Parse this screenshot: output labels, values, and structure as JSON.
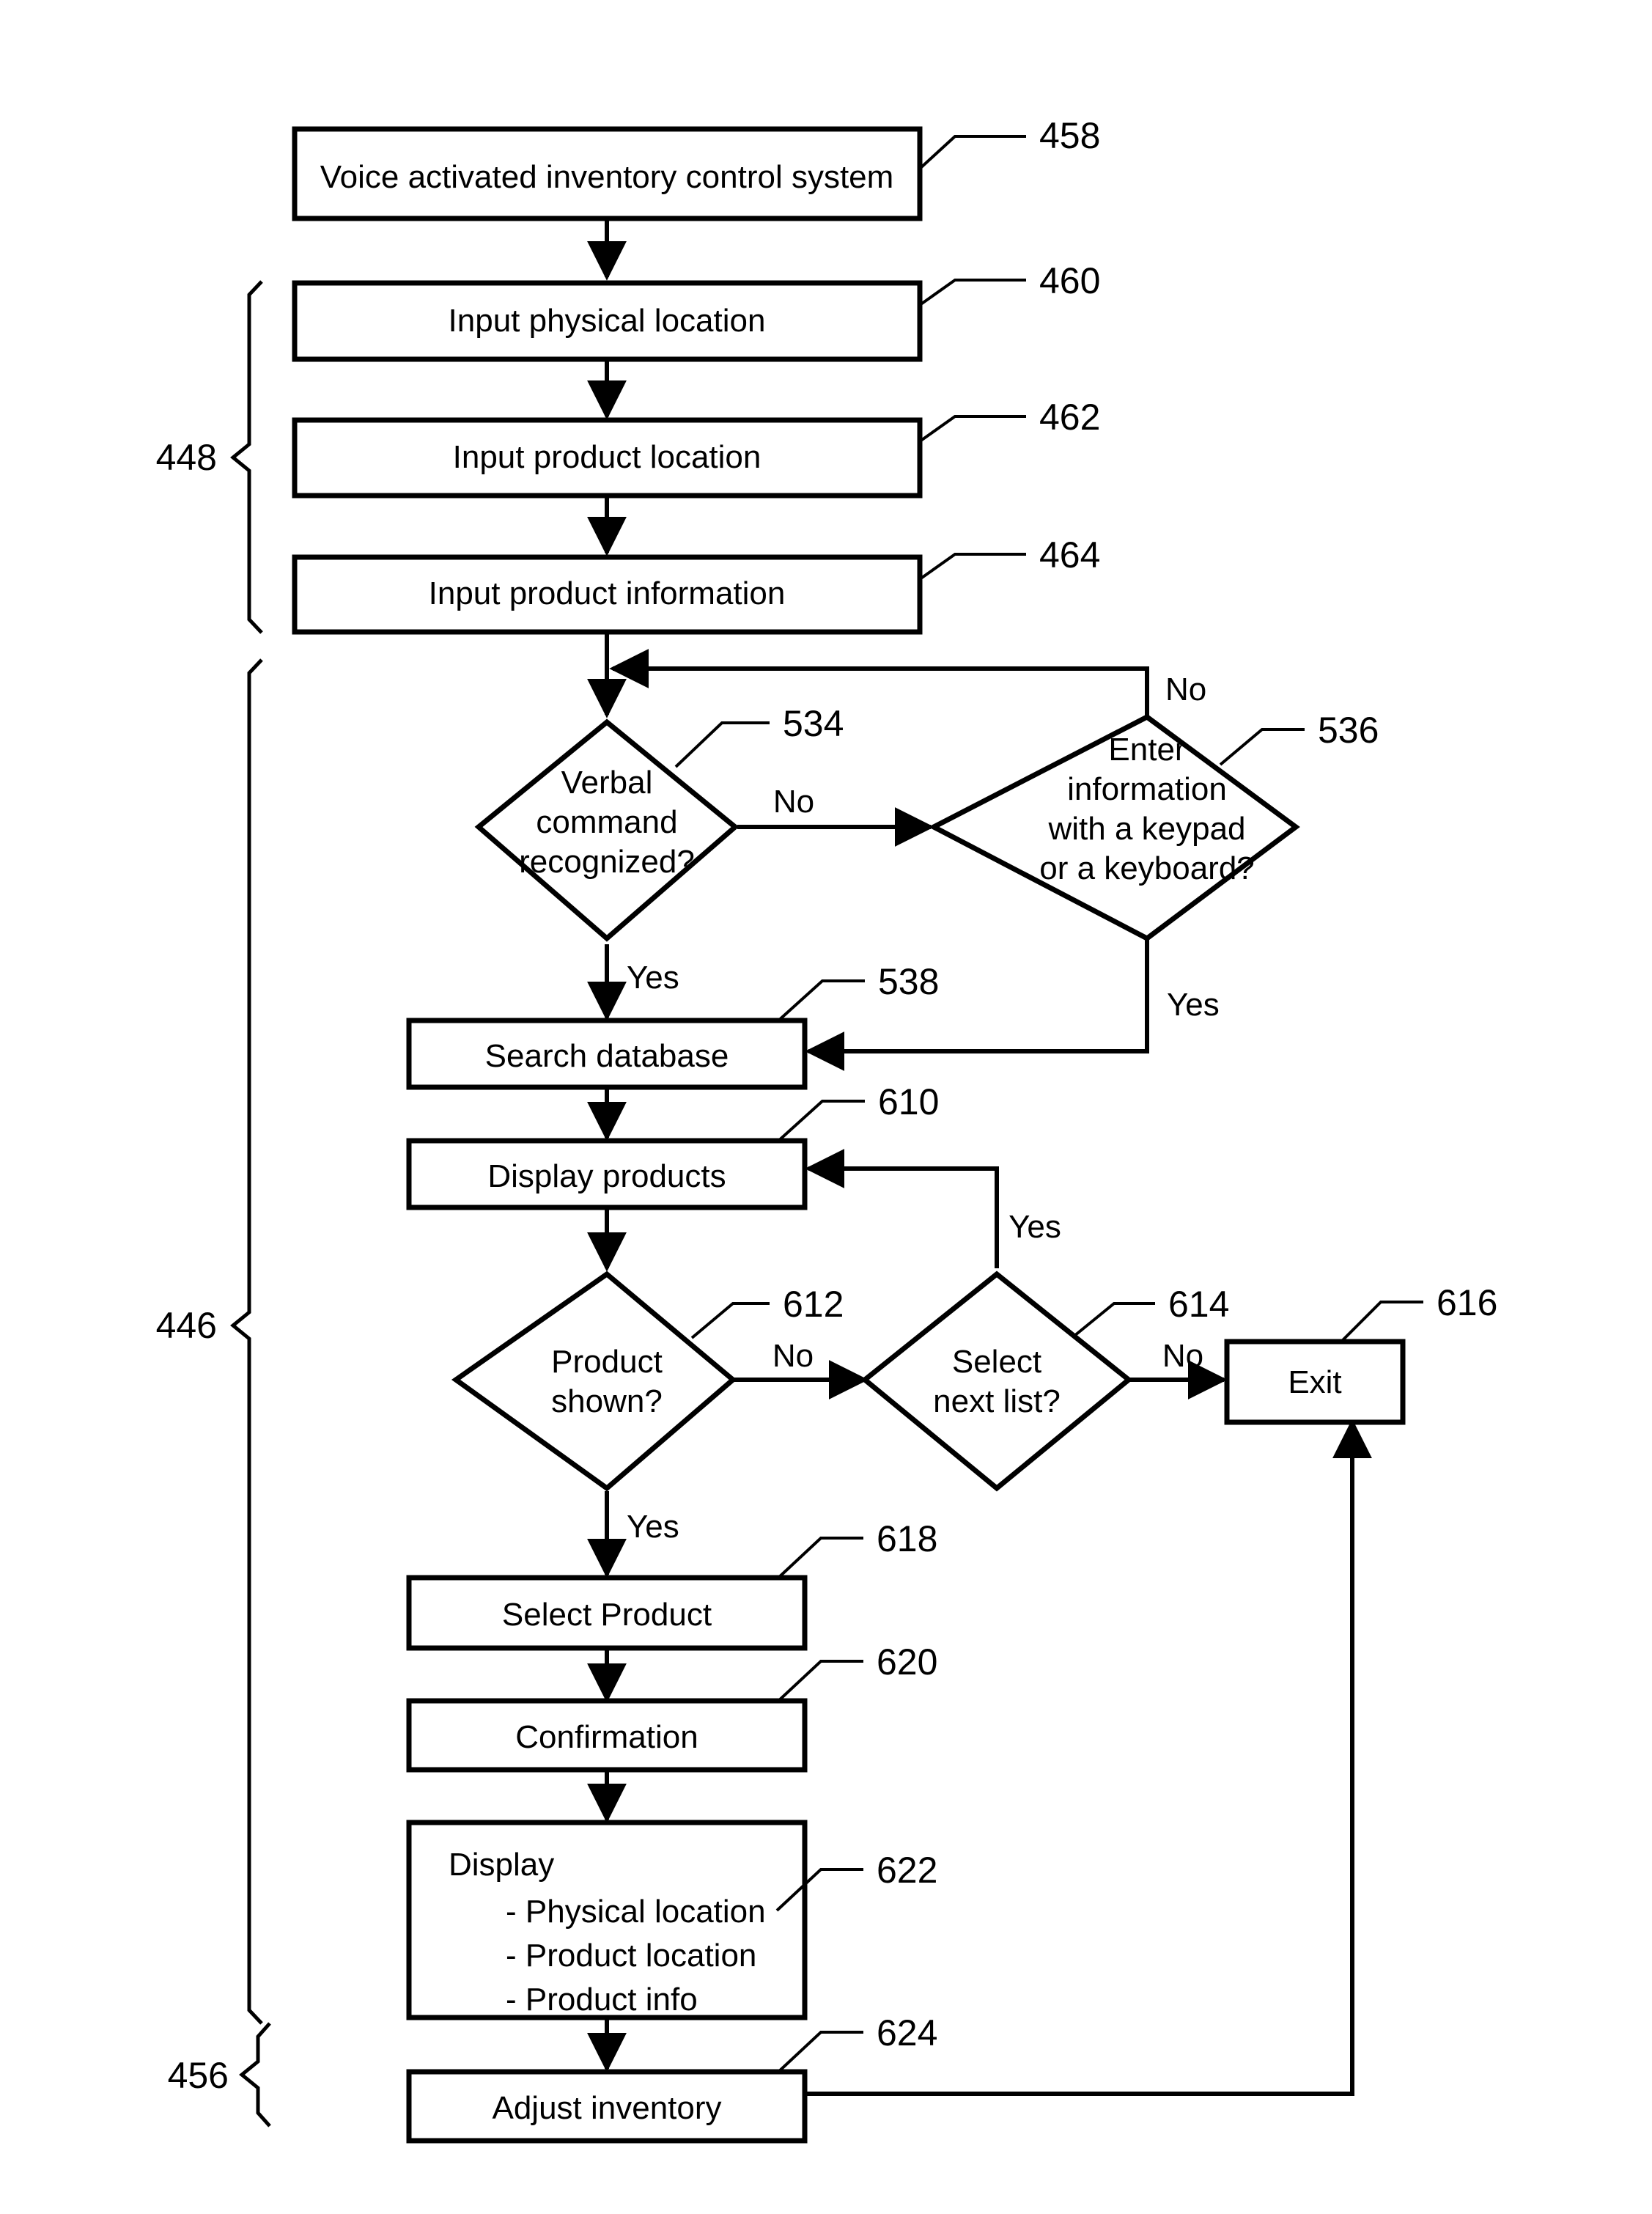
{
  "figure": {
    "kind": "patent-flowchart",
    "nodes": [
      {
        "id": "n458",
        "ref": "458",
        "label": "Voice activated inventory control system",
        "shape": "rect"
      },
      {
        "id": "n460",
        "ref": "460",
        "label": "Input physical location",
        "shape": "rect"
      },
      {
        "id": "n462",
        "ref": "462",
        "label": "Input product location",
        "shape": "rect"
      },
      {
        "id": "n464",
        "ref": "464",
        "label": "Input product information",
        "shape": "rect"
      },
      {
        "id": "n534",
        "ref": "534",
        "label": "Verbal command recognized?",
        "shape": "diamond",
        "lines": [
          "Verbal",
          "command",
          "recognized?"
        ]
      },
      {
        "id": "n536",
        "ref": "536",
        "label": "Enter information with a keypad or a keyboard?",
        "shape": "diamond",
        "lines": [
          "Enter",
          "information",
          "with a keypad",
          "or a keyboard?"
        ]
      },
      {
        "id": "n538",
        "ref": "538",
        "label": "Search database",
        "shape": "rect"
      },
      {
        "id": "n610",
        "ref": "610",
        "label": "Display products",
        "shape": "rect"
      },
      {
        "id": "n612",
        "ref": "612",
        "label": "Product shown?",
        "shape": "diamond",
        "lines": [
          "Product",
          "shown?"
        ]
      },
      {
        "id": "n614",
        "ref": "614",
        "label": "Select next list?",
        "shape": "diamond",
        "lines": [
          "Select",
          "next list?"
        ]
      },
      {
        "id": "n616",
        "ref": "616",
        "label": "Exit",
        "shape": "rect"
      },
      {
        "id": "n618",
        "ref": "618",
        "label": "Select Product",
        "shape": "rect"
      },
      {
        "id": "n620",
        "ref": "620",
        "label": "Confirmation",
        "shape": "rect"
      },
      {
        "id": "n622",
        "ref": "622",
        "label": "Display",
        "shape": "rect",
        "lines": [
          "Display",
          "- Physical location",
          "- Product location",
          "- Product info"
        ]
      },
      {
        "id": "n624",
        "ref": "624",
        "label": "Adjust inventory",
        "shape": "rect"
      }
    ],
    "branch_labels": {
      "n534_no": "No",
      "n534_yes": "Yes",
      "n536_no": "No",
      "n536_yes": "Yes",
      "n612_no": "No",
      "n612_yes": "Yes",
      "n614_yes": "Yes",
      "n614_no": "No"
    },
    "group_braces": [
      {
        "ref": "448",
        "spans": "460-464"
      },
      {
        "ref": "446",
        "spans": "534-624"
      },
      {
        "ref": "456",
        "spans": "624"
      }
    ],
    "colors": {
      "ink": "#000000",
      "paper": "#ffffff"
    }
  }
}
